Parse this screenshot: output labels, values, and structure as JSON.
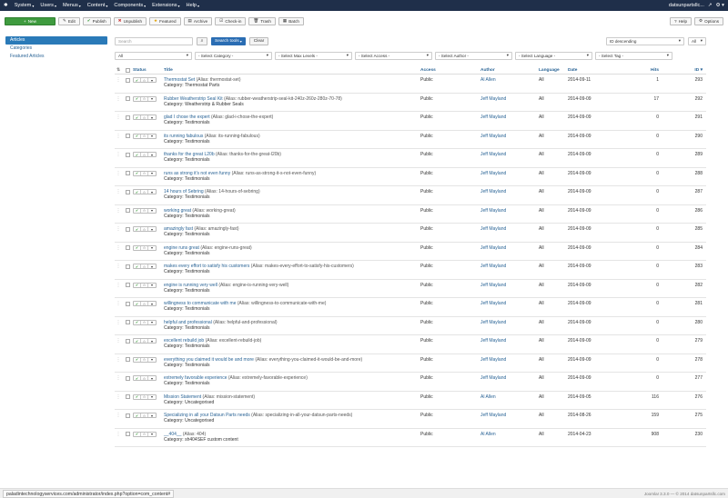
{
  "topnav": {
    "menu": [
      "System",
      "Users",
      "Menus",
      "Content",
      "Components",
      "Extensions",
      "Help"
    ],
    "site": "datsunpartsllc..."
  },
  "toolbar": {
    "new": "New",
    "edit": "Edit",
    "publish": "Publish",
    "unpublish": "Unpublish",
    "featured": "Featured",
    "archive": "Archive",
    "checkin": "Check-in",
    "trash": "Trash",
    "batch": "Batch",
    "help": "Help",
    "options": "Options"
  },
  "sidebar": {
    "items": [
      "Articles",
      "Categories",
      "Featured Articles"
    ]
  },
  "filters": {
    "search_placeholder": "Search",
    "search_tools": "Search tools",
    "clear": "Clear",
    "ordering": "ID descending",
    "limit": "All",
    "published": "All",
    "category": "- Select Category -",
    "max_levels": "- Select Max Levels -",
    "access": "- Select Access -",
    "author": "- Select Author -",
    "language": "- Select Language -",
    "tag": "- Select Tag -"
  },
  "table": {
    "headers": {
      "status": "Status",
      "title": "Title",
      "access": "Access",
      "author": "Author",
      "language": "Language",
      "date": "Date",
      "hits": "Hits",
      "id": "ID"
    },
    "rows": [
      {
        "title": "Thermostat Set",
        "alias": "(Alias: thermostat-set)",
        "category": "Category: Thermostat Parts",
        "access": "Public",
        "author": "Al Allen",
        "lang": "All",
        "date": "2014-09-11",
        "hits": "1",
        "id": "293"
      },
      {
        "title": "Rubber Weatherstrip Seal Kit",
        "alias": "(Alias: rubber-weatherstrip-seal-kit-240z-260z-280z-70-78)",
        "category": "Category: Weatherstrip & Rubber Seals",
        "access": "Public",
        "author": "Jeff Mayland",
        "lang": "All",
        "date": "2014-09-09",
        "hits": "17",
        "id": "292"
      },
      {
        "title": "glad I chose the expert",
        "alias": "(Alias: glad-i-chose-the-expert)",
        "category": "Category: Testimonials",
        "access": "Public",
        "author": "Jeff Mayland",
        "lang": "All",
        "date": "2014-09-09",
        "hits": "0",
        "id": "291"
      },
      {
        "title": "its running fabulous",
        "alias": "(Alias: its-running-fabulous)",
        "category": "Category: Testimonials",
        "access": "Public",
        "author": "Jeff Mayland",
        "lang": "All",
        "date": "2014-09-09",
        "hits": "0",
        "id": "290"
      },
      {
        "title": "thanks for the great L20b",
        "alias": "(Alias: thanks-for-the-great-l20b)",
        "category": "Category: Testimonials",
        "access": "Public",
        "author": "Jeff Mayland",
        "lang": "All",
        "date": "2014-09-09",
        "hits": "0",
        "id": "289"
      },
      {
        "title": "runs as strong it's not even funny",
        "alias": "(Alias: runs-as-strong-it-s-not-even-funny)",
        "category": "Category: Testimonials",
        "access": "Public",
        "author": "Jeff Mayland",
        "lang": "All",
        "date": "2014-09-09",
        "hits": "0",
        "id": "288"
      },
      {
        "title": "14 hours of Sebring",
        "alias": "(Alias: 14-hours-of-sebring)",
        "category": "Category: Testimonials",
        "access": "Public",
        "author": "Jeff Mayland",
        "lang": "All",
        "date": "2014-09-09",
        "hits": "0",
        "id": "287"
      },
      {
        "title": "working great",
        "alias": "(Alias: working-great)",
        "category": "Category: Testimonials",
        "access": "Public",
        "author": "Jeff Mayland",
        "lang": "All",
        "date": "2014-09-09",
        "hits": "0",
        "id": "286"
      },
      {
        "title": "amazingly fast",
        "alias": "(Alias: amazingly-fast)",
        "category": "Category: Testimonials",
        "access": "Public",
        "author": "Jeff Mayland",
        "lang": "All",
        "date": "2014-09-09",
        "hits": "0",
        "id": "285"
      },
      {
        "title": "engine runs great",
        "alias": "(Alias: engine-runs-great)",
        "category": "Category: Testimonials",
        "access": "Public",
        "author": "Jeff Mayland",
        "lang": "All",
        "date": "2014-09-09",
        "hits": "0",
        "id": "284"
      },
      {
        "title": "makes every effort to satisfy his customers",
        "alias": "(Alias: makes-every-effort-to-satisfy-his-customers)",
        "category": "Category: Testimonials",
        "access": "Public",
        "author": "Jeff Mayland",
        "lang": "All",
        "date": "2014-09-09",
        "hits": "0",
        "id": "283"
      },
      {
        "title": "engine is running very well",
        "alias": "(Alias: engine-is-running-very-well)",
        "category": "Category: Testimonials",
        "access": "Public",
        "author": "Jeff Mayland",
        "lang": "All",
        "date": "2014-09-09",
        "hits": "0",
        "id": "282"
      },
      {
        "title": "willingness to communicate with me",
        "alias": "(Alias: willingness-to-communicate-with-me)",
        "category": "Category: Testimonials",
        "access": "Public",
        "author": "Jeff Mayland",
        "lang": "All",
        "date": "2014-09-09",
        "hits": "0",
        "id": "281"
      },
      {
        "title": "helpful and professional",
        "alias": "(Alias: helpful-and-professional)",
        "category": "Category: Testimonials",
        "access": "Public",
        "author": "Jeff Mayland",
        "lang": "All",
        "date": "2014-09-09",
        "hits": "0",
        "id": "280"
      },
      {
        "title": "excellent rebuild job",
        "alias": "(Alias: excellent-rebuild-job)",
        "category": "Category: Testimonials",
        "access": "Public",
        "author": "Jeff Mayland",
        "lang": "All",
        "date": "2014-09-09",
        "hits": "0",
        "id": "279"
      },
      {
        "title": "everything you claimed it would be and more",
        "alias": "(Alias: everything-you-claimed-it-would-be-and-more)",
        "category": "Category: Testimonials",
        "access": "Public",
        "author": "Jeff Mayland",
        "lang": "All",
        "date": "2014-09-09",
        "hits": "0",
        "id": "278"
      },
      {
        "title": "extremely favorable experience",
        "alias": "(Alias: extremely-favorable-experience)",
        "category": "Category: Testimonials",
        "access": "Public",
        "author": "Jeff Mayland",
        "lang": "All",
        "date": "2014-09-09",
        "hits": "0",
        "id": "277"
      },
      {
        "title": "Mission Statement",
        "alias": "(Alias: mission-statement)",
        "category": "Category: Uncategorised",
        "access": "Public",
        "author": "Al Allen",
        "lang": "All",
        "date": "2014-09-05",
        "hits": "116",
        "id": "276"
      },
      {
        "title": "Specializing in all your Datsun Parts needs",
        "alias": "(Alias: specializing-in-all-your-datsun-parts-needs)",
        "category": "Category: Uncategorised",
        "access": "Public",
        "author": "Jeff Mayland",
        "lang": "All",
        "date": "2014-08-26",
        "hits": "159",
        "id": "275"
      },
      {
        "title": "__404__",
        "alias": "(Alias: 404)",
        "category": "Category: sh404SEF custom content",
        "access": "Public",
        "author": "Al Allen",
        "lang": "All",
        "date": "2014-04-23",
        "hits": "908",
        "id": "230"
      }
    ]
  },
  "statusbar": {
    "url": "paladintechnologyservices.com/administrator/index.php?option=com_content#",
    "version": "Joomla! 3.3.0 — © 2014 datsunpartsllc.com"
  }
}
